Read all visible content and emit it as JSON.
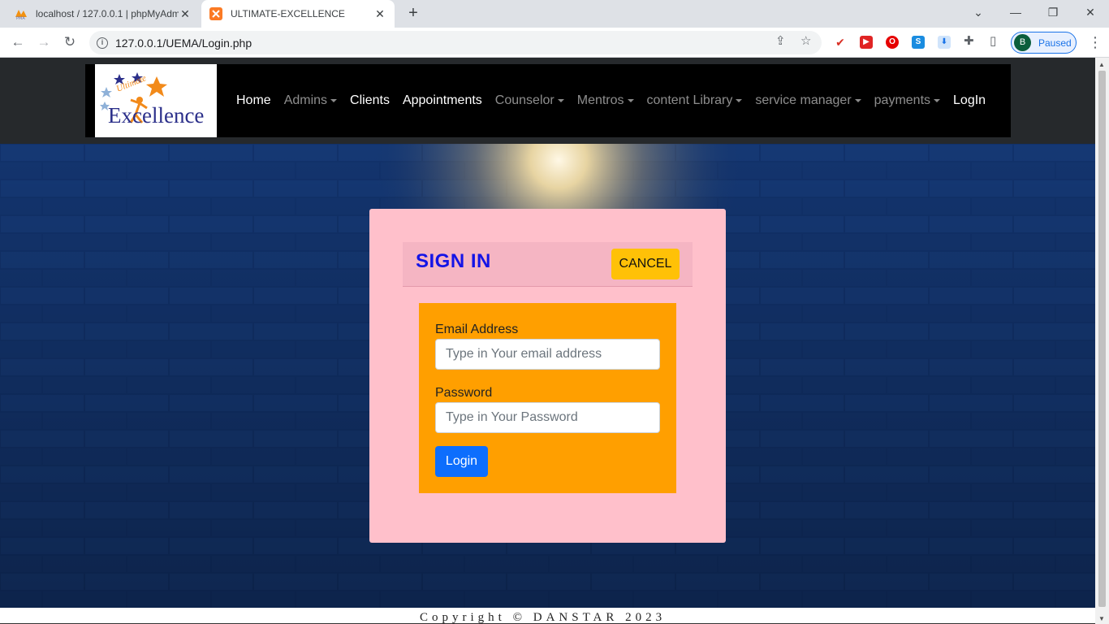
{
  "browser": {
    "tabs": [
      {
        "title": "localhost / 127.0.0.1 | phpMyAdmin",
        "active": false
      },
      {
        "title": "ULTIMATE-EXCELLENCE",
        "active": true
      }
    ],
    "url": "127.0.0.1/UEMA/Login.php",
    "profile_initial": "B",
    "profile_status": "Paused"
  },
  "brand": {
    "logo_word_small": "Ultimate",
    "logo_word_large": "Excellence"
  },
  "nav": {
    "home": "Home",
    "admins": "Admins",
    "clients": "Clients",
    "appointments": "Appointments",
    "counselor": "Counselor",
    "mentros": "Mentros",
    "content_library": "content Library",
    "service_manager": "service manager",
    "payments": "payments",
    "login": "LogIn"
  },
  "signin": {
    "title": "SIGN IN",
    "cancel_label": "CANCEL",
    "email_label": "Email Address",
    "email_placeholder": "Type in Your email address",
    "password_label": "Password",
    "password_placeholder": "Type in Your Password",
    "login_label": "Login"
  },
  "footer": {
    "text": "Copyright © DANSTAR 2023"
  },
  "colors": {
    "card": "#ffc0cb",
    "form_box": "#ff9f00",
    "cancel": "#ffc107",
    "login": "#0d6efd",
    "title": "#1414e6",
    "wall": "#0f2d63"
  }
}
